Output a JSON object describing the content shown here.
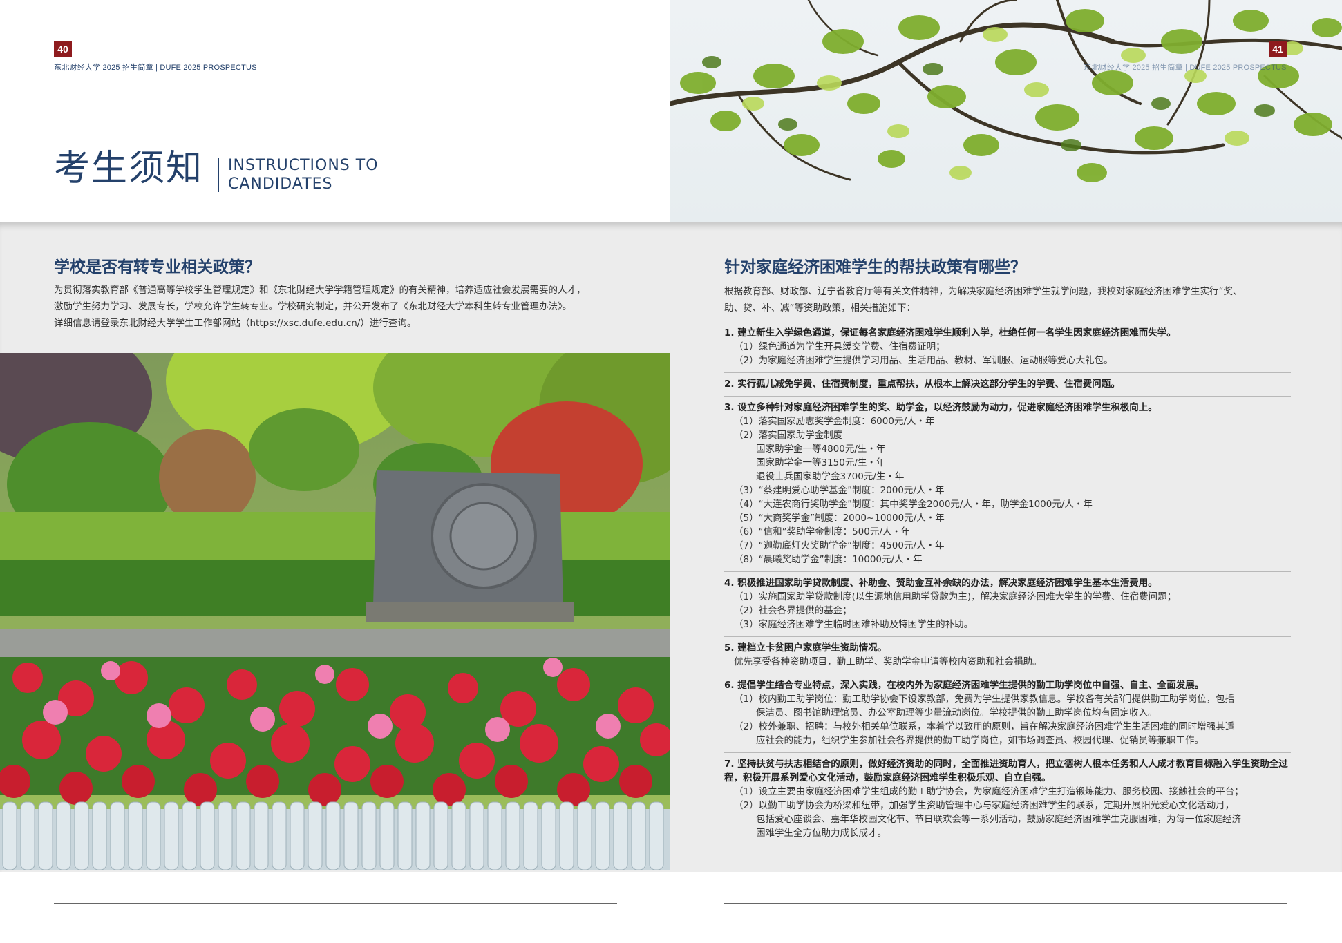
{
  "left_page": {
    "page_number": "40",
    "running_head": "东北财经大学 2025 招生简章 | DUFE 2025 PROSPECTUS",
    "section_title_cn": "考生须知",
    "section_title_en_line1": "INSTRUCTIONS TO",
    "section_title_en_line2": "CANDIDATES",
    "question": "学校是否有转专业相关政策？",
    "answer_lines": [
      "为贯彻落实教育部《普通高等学校学生管理规定》和《东北财经大学学籍管理规定》的有关精神，培养适应社会发展需要的人才，",
      "激励学生努力学习、发展专长，学校允许学生转专业。学校研究制定，并公开发布了《东北财经大学本科生转专业管理办法》。",
      "详细信息请登录东北财经大学学生工作部网站（https://xsc.dufe.edu.cn/）进行查询。"
    ]
  },
  "right_page": {
    "page_number": "41",
    "running_head": "东北财经大学 2025 招生简章 | DUFE 2025 PROSPECTUS",
    "question": "针对家庭经济困难学生的帮扶政策有哪些？",
    "intro_lines": [
      "根据教育部、财政部、辽宁省教育厅等有关文件精神，为解决家庭经济困难学生就学问题，我校对家庭经济困难学生实行“奖、",
      "助、贷、补、减”等资助政策，相关措施如下："
    ],
    "items": [
      {
        "head": "1. 建立新生入学绿色通道，保证每名家庭经济困难学生顺利入学，杜绝任何一名学生因家庭经济困难而失学。",
        "lines": [
          {
            "text": "（1）绿色通道为学生开具缓交学费、住宿费证明；",
            "indent": 1
          },
          {
            "text": "（2）为家庭经济困难学生提供学习用品、生活用品、教材、军训服、运动服等爱心大礼包。",
            "indent": 1
          }
        ]
      },
      {
        "head": "2. 实行孤儿减免学费、住宿费制度，重点帮扶，从根本上解决这部分学生的学费、住宿费问题。",
        "lines": []
      },
      {
        "head": "3. 设立多种针对家庭经济困难学生的奖、助学金，以经济鼓励为动力，促进家庭经济困难学生积极向上。",
        "lines": [
          {
            "text": "（1）落实国家励志奖学金制度：6000元/人・年",
            "indent": 1
          },
          {
            "text": "（2）落实国家助学金制度",
            "indent": 1
          },
          {
            "text": "国家助学金一等4800元/生・年",
            "indent": 2
          },
          {
            "text": "国家助学金一等3150元/生・年",
            "indent": 2
          },
          {
            "text": "退役士兵国家助学金3700元/生・年",
            "indent": 2
          },
          {
            "text": "（3）“蔡建明爱心助学基金”制度：2000元/人・年",
            "indent": 1
          },
          {
            "text": "（4）“大连农商行奖助学金”制度：其中奖学金2000元/人・年，助学金1000元/人・年",
            "indent": 1
          },
          {
            "text": "（5）“大商奖学金”制度：2000~10000元/人・年",
            "indent": 1
          },
          {
            "text": "（6）“信和”奖助学金制度：500元/人・年",
            "indent": 1
          },
          {
            "text": "（7）“迦勒底灯火奖助学金”制度：4500元/人・年",
            "indent": 1
          },
          {
            "text": "（8）“晨曦奖助学金”制度：10000元/人・年",
            "indent": 1
          }
        ]
      },
      {
        "head": "4. 积极推进国家助学贷款制度、补助金、赞助金互补余缺的办法，解决家庭经济困难学生基本生活费用。",
        "lines": [
          {
            "text": "（1）实施国家助学贷款制度(以生源地信用助学贷款为主)，解决家庭经济困难大学生的学费、住宿费问题；",
            "indent": 1
          },
          {
            "text": "（2）社会各界提供的基金；",
            "indent": 1
          },
          {
            "text": "（3）家庭经济困难学生临时困难补助及特困学生的补助。",
            "indent": 1
          }
        ]
      },
      {
        "head": "5. 建档立卡贫困户家庭学生资助情况。",
        "lines": [
          {
            "text": "优先享受各种资助项目，勤工助学、奖助学金申请等校内资助和社会捐助。",
            "indent": 1
          }
        ]
      },
      {
        "head": "6. 提倡学生结合专业特点，深入实践，在校内外为家庭经济困难学生提供的勤工助学岗位中自强、自主、全面发展。",
        "lines": [
          {
            "text": "（1）校内勤工助学岗位：勤工助学协会下设家教部，免费为学生提供家教信息。学校各有关部门提供勤工助学岗位，包括",
            "indent": 1
          },
          {
            "text": "保洁员、图书馆助理馆员、办公室助理等少量流动岗位。学校提供的勤工助学岗位均有固定收入。",
            "indent": 2
          },
          {
            "text": "（2）校外兼职、招聘：与校外相关单位联系，本着学以致用的原则，旨在解决家庭经济困难学生生活困难的同时增强其适",
            "indent": 1
          },
          {
            "text": "应社会的能力，组织学生参加社会各界提供的勤工助学岗位，如市场调查员、校园代理、促销员等兼职工作。",
            "indent": 2
          }
        ]
      },
      {
        "head": "7. 坚持扶贫与扶志相结合的原则，做好经济资助的同时，全面推进资助育人，把立德树人根本任务和人人成才教育目标融入学生资助全过程，积极开展系列爱心文化活动，鼓励家庭经济困难学生积极乐观、自立自强。",
        "lines": [
          {
            "text": "（1）设立主要由家庭经济困难学生组成的勤工助学协会，为家庭经济困难学生打造锻炼能力、服务校园、接触社会的平台；",
            "indent": 1
          },
          {
            "text": "（2）以勤工助学协会为桥梁和纽带，加强学生资助管理中心与家庭经济困难学生的联系，定期开展阳光爱心文化活动月，",
            "indent": 1
          },
          {
            "text": "包括爱心座谈会、嘉年华校园文化节、节日联欢会等一系列活动，鼓励家庭经济困难学生克服困难，为每一位家庭经济",
            "indent": 2
          },
          {
            "text": "困难学生全方位助力成长成才。",
            "indent": 2
          }
        ]
      }
    ]
  },
  "colors": {
    "navy": "#24416b",
    "page_badge": "#8e1b1e",
    "body_grey": "#ececec"
  }
}
